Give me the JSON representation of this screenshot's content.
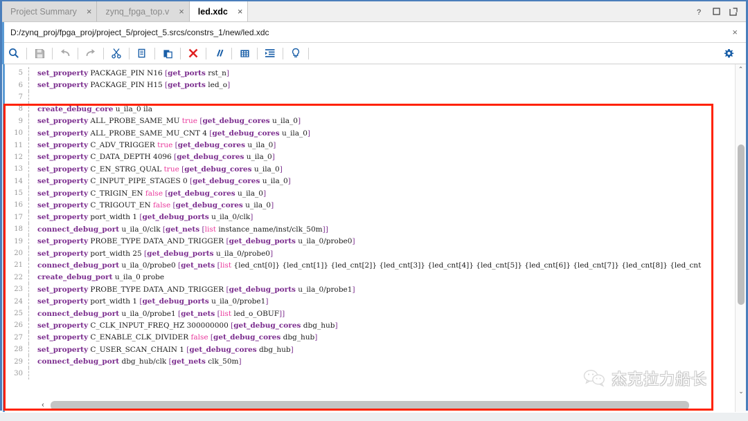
{
  "window": {
    "controls": [
      {
        "name": "help-icon",
        "glyph": "?"
      },
      {
        "name": "maximize-icon",
        "glyph": "□"
      },
      {
        "name": "float-window-icon",
        "glyph": "↗"
      }
    ]
  },
  "tabs": [
    {
      "label": "Project Summary",
      "active": false,
      "close": "×"
    },
    {
      "label": "zynq_fpga_top.v",
      "active": false,
      "close": "×"
    },
    {
      "label": "led.xdc",
      "active": true,
      "close": "×"
    }
  ],
  "path_bar": {
    "path": "D:/zynq_proj/fpga_proj/project_5/project_5.srcs/constrs_1/new/led.xdc",
    "close_label": "×"
  },
  "toolbar": {
    "items": [
      {
        "name": "find-icon",
        "title": "Find"
      },
      {
        "name": "save-icon",
        "title": "Save File"
      },
      {
        "name": "undo-icon",
        "title": "Undo"
      },
      {
        "name": "redo-icon",
        "title": "Redo"
      },
      {
        "name": "cut-icon",
        "title": "Cut"
      },
      {
        "name": "copy-icon",
        "title": "Copy"
      },
      {
        "name": "paste-icon",
        "title": "Paste"
      },
      {
        "name": "delete-icon",
        "title": "Delete"
      },
      {
        "name": "comment-icon",
        "title": "Toggle Comment"
      },
      {
        "name": "column-select-icon",
        "title": "Column Select"
      },
      {
        "name": "indent-icon",
        "title": "Indent"
      },
      {
        "name": "hint-icon",
        "title": "Show Hints"
      }
    ],
    "settings": {
      "name": "gear-icon",
      "title": "Settings"
    }
  },
  "editor": {
    "lines": [
      {
        "num": "5",
        "tokens": [
          {
            "t": "cmd",
            "v": "set_property"
          },
          {
            "t": "plain",
            "v": " PACKAGE_PIN N16 "
          },
          {
            "t": "brk",
            "v": "["
          },
          {
            "t": "kw",
            "v": "get_ports"
          },
          {
            "t": "plain",
            "v": " rst_n"
          },
          {
            "t": "brk",
            "v": "]"
          }
        ]
      },
      {
        "num": "6",
        "tokens": [
          {
            "t": "cmd",
            "v": "set_property"
          },
          {
            "t": "plain",
            "v": " PACKAGE_PIN H15 "
          },
          {
            "t": "brk",
            "v": "["
          },
          {
            "t": "kw",
            "v": "get_ports"
          },
          {
            "t": "plain",
            "v": " led_o"
          },
          {
            "t": "brk",
            "v": "]"
          }
        ]
      },
      {
        "num": "7",
        "tokens": []
      },
      {
        "num": "8",
        "tokens": [
          {
            "t": "cmd",
            "v": "create_debug_core"
          },
          {
            "t": "plain",
            "v": " u_ila_0 ila"
          }
        ]
      },
      {
        "num": "9",
        "tokens": [
          {
            "t": "cmd",
            "v": "set_property"
          },
          {
            "t": "plain",
            "v": " ALL_PROBE_SAME_MU "
          },
          {
            "t": "lit",
            "v": "true"
          },
          {
            "t": "plain",
            "v": " "
          },
          {
            "t": "brk",
            "v": "["
          },
          {
            "t": "kw",
            "v": "get_debug_cores"
          },
          {
            "t": "plain",
            "v": " u_ila_0"
          },
          {
            "t": "brk",
            "v": "]"
          }
        ]
      },
      {
        "num": "10",
        "tokens": [
          {
            "t": "cmd",
            "v": "set_property"
          },
          {
            "t": "plain",
            "v": " ALL_PROBE_SAME_MU_CNT 4 "
          },
          {
            "t": "brk",
            "v": "["
          },
          {
            "t": "kw",
            "v": "get_debug_cores"
          },
          {
            "t": "plain",
            "v": " u_ila_0"
          },
          {
            "t": "brk",
            "v": "]"
          }
        ]
      },
      {
        "num": "11",
        "tokens": [
          {
            "t": "cmd",
            "v": "set_property"
          },
          {
            "t": "plain",
            "v": " C_ADV_TRIGGER "
          },
          {
            "t": "lit",
            "v": "true"
          },
          {
            "t": "plain",
            "v": " "
          },
          {
            "t": "brk",
            "v": "["
          },
          {
            "t": "kw",
            "v": "get_debug_cores"
          },
          {
            "t": "plain",
            "v": " u_ila_0"
          },
          {
            "t": "brk",
            "v": "]"
          }
        ]
      },
      {
        "num": "12",
        "tokens": [
          {
            "t": "cmd",
            "v": "set_property"
          },
          {
            "t": "plain",
            "v": " C_DATA_DEPTH 4096 "
          },
          {
            "t": "brk",
            "v": "["
          },
          {
            "t": "kw",
            "v": "get_debug_cores"
          },
          {
            "t": "plain",
            "v": " u_ila_0"
          },
          {
            "t": "brk",
            "v": "]"
          }
        ]
      },
      {
        "num": "13",
        "tokens": [
          {
            "t": "cmd",
            "v": "set_property"
          },
          {
            "t": "plain",
            "v": " C_EN_STRG_QUAL "
          },
          {
            "t": "lit",
            "v": "true"
          },
          {
            "t": "plain",
            "v": " "
          },
          {
            "t": "brk",
            "v": "["
          },
          {
            "t": "kw",
            "v": "get_debug_cores"
          },
          {
            "t": "plain",
            "v": " u_ila_0"
          },
          {
            "t": "brk",
            "v": "]"
          }
        ]
      },
      {
        "num": "14",
        "tokens": [
          {
            "t": "cmd",
            "v": "set_property"
          },
          {
            "t": "plain",
            "v": " C_INPUT_PIPE_STAGES 0 "
          },
          {
            "t": "brk",
            "v": "["
          },
          {
            "t": "kw",
            "v": "get_debug_cores"
          },
          {
            "t": "plain",
            "v": " u_ila_0"
          },
          {
            "t": "brk",
            "v": "]"
          }
        ]
      },
      {
        "num": "15",
        "tokens": [
          {
            "t": "cmd",
            "v": "set_property"
          },
          {
            "t": "plain",
            "v": " C_TRIGIN_EN "
          },
          {
            "t": "lit",
            "v": "false"
          },
          {
            "t": "plain",
            "v": " "
          },
          {
            "t": "brk",
            "v": "["
          },
          {
            "t": "kw",
            "v": "get_debug_cores"
          },
          {
            "t": "plain",
            "v": " u_ila_0"
          },
          {
            "t": "brk",
            "v": "]"
          }
        ]
      },
      {
        "num": "16",
        "tokens": [
          {
            "t": "cmd",
            "v": "set_property"
          },
          {
            "t": "plain",
            "v": " C_TRIGOUT_EN "
          },
          {
            "t": "lit",
            "v": "false"
          },
          {
            "t": "plain",
            "v": " "
          },
          {
            "t": "brk",
            "v": "["
          },
          {
            "t": "kw",
            "v": "get_debug_cores"
          },
          {
            "t": "plain",
            "v": " u_ila_0"
          },
          {
            "t": "brk",
            "v": "]"
          }
        ]
      },
      {
        "num": "17",
        "tokens": [
          {
            "t": "cmd",
            "v": "set_property"
          },
          {
            "t": "plain",
            "v": " port_width 1 "
          },
          {
            "t": "brk",
            "v": "["
          },
          {
            "t": "kw",
            "v": "get_debug_ports"
          },
          {
            "t": "plain",
            "v": " u_ila_0/clk"
          },
          {
            "t": "brk",
            "v": "]"
          }
        ]
      },
      {
        "num": "18",
        "tokens": [
          {
            "t": "cmd",
            "v": "connect_debug_port"
          },
          {
            "t": "plain",
            "v": " u_ila_0/clk "
          },
          {
            "t": "brk",
            "v": "["
          },
          {
            "t": "kw",
            "v": "get_nets"
          },
          {
            "t": "plain",
            "v": " "
          },
          {
            "t": "brk",
            "v": "["
          },
          {
            "t": "lit",
            "v": "list"
          },
          {
            "t": "plain",
            "v": " instance_name/inst/clk_50m"
          },
          {
            "t": "brk",
            "v": "]]"
          }
        ]
      },
      {
        "num": "19",
        "tokens": [
          {
            "t": "cmd",
            "v": "set_property"
          },
          {
            "t": "plain",
            "v": " PROBE_TYPE DATA_AND_TRIGGER "
          },
          {
            "t": "brk",
            "v": "["
          },
          {
            "t": "kw",
            "v": "get_debug_ports"
          },
          {
            "t": "plain",
            "v": " u_ila_0/probe0"
          },
          {
            "t": "brk",
            "v": "]"
          }
        ]
      },
      {
        "num": "20",
        "tokens": [
          {
            "t": "cmd",
            "v": "set_property"
          },
          {
            "t": "plain",
            "v": " port_width 25 "
          },
          {
            "t": "brk",
            "v": "["
          },
          {
            "t": "kw",
            "v": "get_debug_ports"
          },
          {
            "t": "plain",
            "v": " u_ila_0/probe0"
          },
          {
            "t": "brk",
            "v": "]"
          }
        ]
      },
      {
        "num": "21",
        "tokens": [
          {
            "t": "cmd",
            "v": "connect_debug_port"
          },
          {
            "t": "plain",
            "v": " u_ila_0/probe0 "
          },
          {
            "t": "brk",
            "v": "["
          },
          {
            "t": "kw",
            "v": "get_nets"
          },
          {
            "t": "plain",
            "v": " "
          },
          {
            "t": "brk",
            "v": "["
          },
          {
            "t": "lit",
            "v": "list"
          },
          {
            "t": "plain",
            "v": " {led_cnt[0]} {led_cnt[1]} {led_cnt[2]} {led_cnt[3]} {led_cnt[4]} {led_cnt[5]} {led_cnt[6]} {led_cnt[7]} {led_cnt[8]} {led_cnt"
          }
        ]
      },
      {
        "num": "22",
        "tokens": [
          {
            "t": "cmd",
            "v": "create_debug_port"
          },
          {
            "t": "plain",
            "v": " u_ila_0 probe"
          }
        ]
      },
      {
        "num": "23",
        "tokens": [
          {
            "t": "cmd",
            "v": "set_property"
          },
          {
            "t": "plain",
            "v": " PROBE_TYPE DATA_AND_TRIGGER "
          },
          {
            "t": "brk",
            "v": "["
          },
          {
            "t": "kw",
            "v": "get_debug_ports"
          },
          {
            "t": "plain",
            "v": " u_ila_0/probe1"
          },
          {
            "t": "brk",
            "v": "]"
          }
        ]
      },
      {
        "num": "24",
        "tokens": [
          {
            "t": "cmd",
            "v": "set_property"
          },
          {
            "t": "plain",
            "v": " port_width 1 "
          },
          {
            "t": "brk",
            "v": "["
          },
          {
            "t": "kw",
            "v": "get_debug_ports"
          },
          {
            "t": "plain",
            "v": " u_ila_0/probe1"
          },
          {
            "t": "brk",
            "v": "]"
          }
        ]
      },
      {
        "num": "25",
        "tokens": [
          {
            "t": "cmd",
            "v": "connect_debug_port"
          },
          {
            "t": "plain",
            "v": " u_ila_0/probe1 "
          },
          {
            "t": "brk",
            "v": "["
          },
          {
            "t": "kw",
            "v": "get_nets"
          },
          {
            "t": "plain",
            "v": " "
          },
          {
            "t": "brk",
            "v": "["
          },
          {
            "t": "lit",
            "v": "list"
          },
          {
            "t": "plain",
            "v": " led_o_OBUF"
          },
          {
            "t": "brk",
            "v": "]]"
          }
        ]
      },
      {
        "num": "26",
        "tokens": [
          {
            "t": "cmd",
            "v": "set_property"
          },
          {
            "t": "plain",
            "v": " C_CLK_INPUT_FREQ_HZ 300000000 "
          },
          {
            "t": "brk",
            "v": "["
          },
          {
            "t": "kw",
            "v": "get_debug_cores"
          },
          {
            "t": "plain",
            "v": " dbg_hub"
          },
          {
            "t": "brk",
            "v": "]"
          }
        ]
      },
      {
        "num": "27",
        "tokens": [
          {
            "t": "cmd",
            "v": "set_property"
          },
          {
            "t": "plain",
            "v": " C_ENABLE_CLK_DIVIDER "
          },
          {
            "t": "lit",
            "v": "false"
          },
          {
            "t": "plain",
            "v": " "
          },
          {
            "t": "brk",
            "v": "["
          },
          {
            "t": "kw",
            "v": "get_debug_cores"
          },
          {
            "t": "plain",
            "v": " dbg_hub"
          },
          {
            "t": "brk",
            "v": "]"
          }
        ]
      },
      {
        "num": "28",
        "tokens": [
          {
            "t": "cmd",
            "v": "set_property"
          },
          {
            "t": "plain",
            "v": " C_USER_SCAN_CHAIN 1 "
          },
          {
            "t": "brk",
            "v": "["
          },
          {
            "t": "kw",
            "v": "get_debug_cores"
          },
          {
            "t": "plain",
            "v": " dbg_hub"
          },
          {
            "t": "brk",
            "v": "]"
          }
        ]
      },
      {
        "num": "29",
        "tokens": [
          {
            "t": "cmd",
            "v": "connect_debug_port"
          },
          {
            "t": "plain",
            "v": " dbg_hub/clk "
          },
          {
            "t": "brk",
            "v": "["
          },
          {
            "t": "kw",
            "v": "get_nets"
          },
          {
            "t": "plain",
            "v": " clk_50m"
          },
          {
            "t": "brk",
            "v": "]"
          }
        ]
      },
      {
        "num": "30",
        "tokens": []
      }
    ]
  },
  "scrollbars": {
    "vertical_up": "⌃",
    "vertical_down": "⌄",
    "horizontal_left": "‹",
    "horizontal_right": "›"
  },
  "annotation": {
    "highlight_color": "#ff2200"
  },
  "watermark": {
    "text": "杰克拉力船长",
    "icon": "wechat-icon"
  }
}
